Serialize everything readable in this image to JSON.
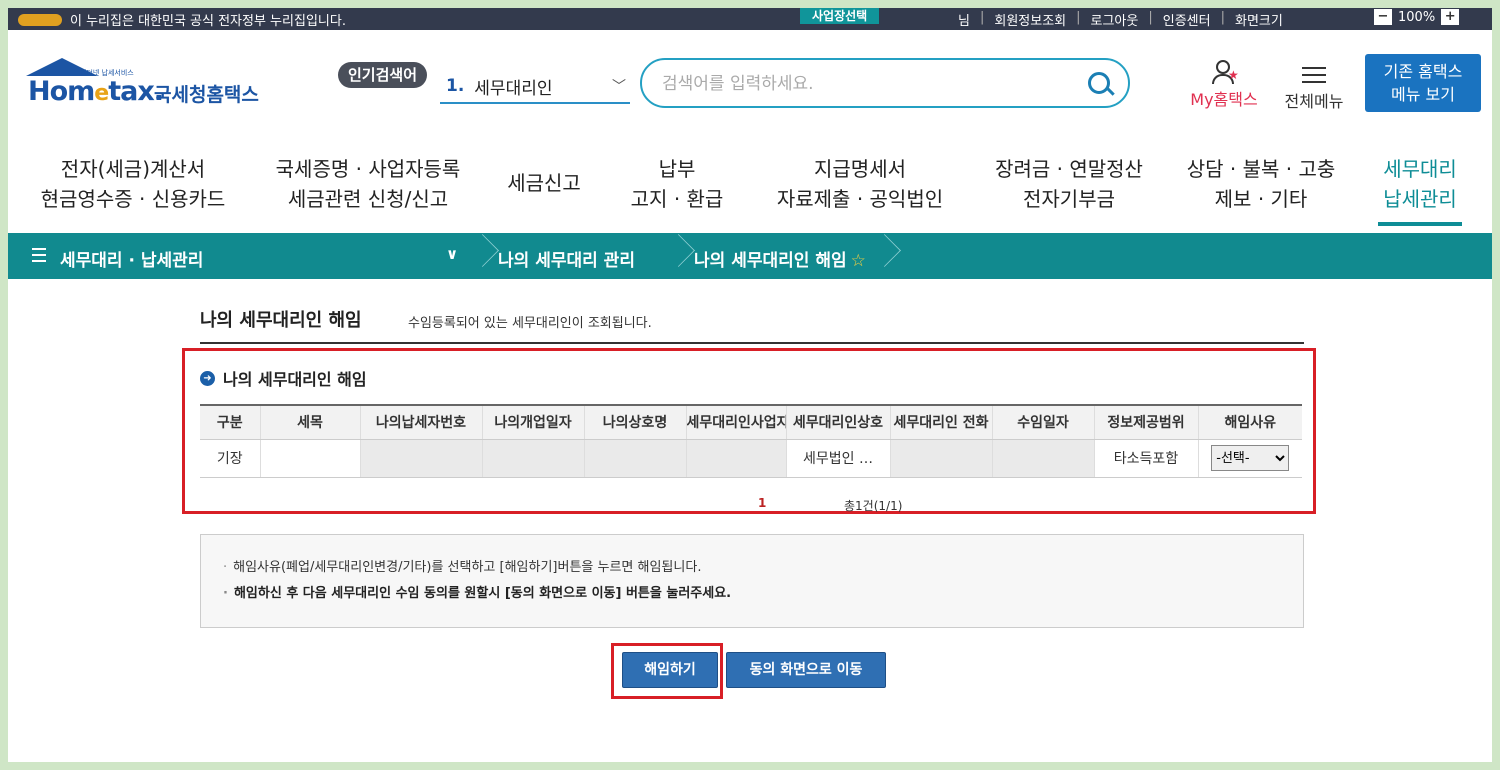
{
  "topbar": {
    "notice": "이 누리집은 대한민국 공식 전자정부 누리집입니다.",
    "biz_select": "사업장선택",
    "links": [
      "님",
      "회원정보조회",
      "로그아웃",
      "인증센터",
      "화면크기"
    ],
    "zoom_minus": "−",
    "zoom_level": "100%",
    "zoom_plus": "+"
  },
  "header": {
    "logo_sub": "인터넷 납세서비스",
    "logo_main_a": "Hom",
    "logo_main_e": "e",
    "logo_main_b": "tax.",
    "logo_kr": "국세청홈택스",
    "popular_label": "인기검색어",
    "popular_num": "1.",
    "popular_term": "세무대리인",
    "search_placeholder": "검색어를 입력하세요.",
    "myhometax": "My홈택스",
    "all_menu": "전체메뉴",
    "legacy_line1": "기존 홈택스",
    "legacy_line2": "메뉴 보기"
  },
  "gnb": [
    {
      "line1": "전자(세금)계산서",
      "line2": "현금영수증 · 신용카드"
    },
    {
      "line1": "국세증명 · 사업자등록",
      "line2": "세금관련 신청/신고"
    },
    {
      "line1": "세금신고",
      "line2": ""
    },
    {
      "line1": "납부",
      "line2": "고지 · 환급"
    },
    {
      "line1": "지급명세서",
      "line2": "자료제출 · 공익법인"
    },
    {
      "line1": "장려금 · 연말정산",
      "line2": "전자기부금"
    },
    {
      "line1": "상담 · 불복 · 고충",
      "line2": "제보 · 기타"
    },
    {
      "line1": "세무대리",
      "line2": "납세관리"
    }
  ],
  "breadcrumb": {
    "level1": "세무대리 · 납세관리",
    "level2": "나의 세무대리 관리",
    "level3": "나의 세무대리인 해임"
  },
  "page": {
    "title": "나의 세무대리인 해임",
    "description": "수임등록되어 있는 세무대리인이 조회됩니다.",
    "section_title": "나의 세무대리인 해임"
  },
  "table": {
    "headers": [
      "구분",
      "세목",
      "나의납세자번호",
      "나의개업일자",
      "나의상호명",
      "세무대리인사업자",
      "세무대리인상호",
      "세무대리인 전화",
      "수임일자",
      "정보제공범위",
      "해임사유"
    ],
    "row": {
      "type": "기장",
      "tax_item": "",
      "agent_firm": "세무법인 …",
      "info_scope": "타소득포함",
      "reason_selected": "-선택-"
    }
  },
  "pager": {
    "current": "1",
    "total": "총1건(1/1)"
  },
  "notice": {
    "line1": "해임사유(폐업/세무대리인변경/기타)를 선택하고 [해임하기]버튼을 누르면 해임됩니다.",
    "line2": "해임하신 후 다음 세무대리인 수임 동의를 원할시 [동의 화면으로 이동] 버튼을 눌러주세요."
  },
  "buttons": {
    "dismiss": "해임하기",
    "go_consent": "동의 화면으로 이동"
  },
  "colors": {
    "accent_teal": "#118a8f",
    "brand_blue": "#1c55a4",
    "highlight_red": "#d81f26",
    "button_blue": "#2f6fb3"
  }
}
